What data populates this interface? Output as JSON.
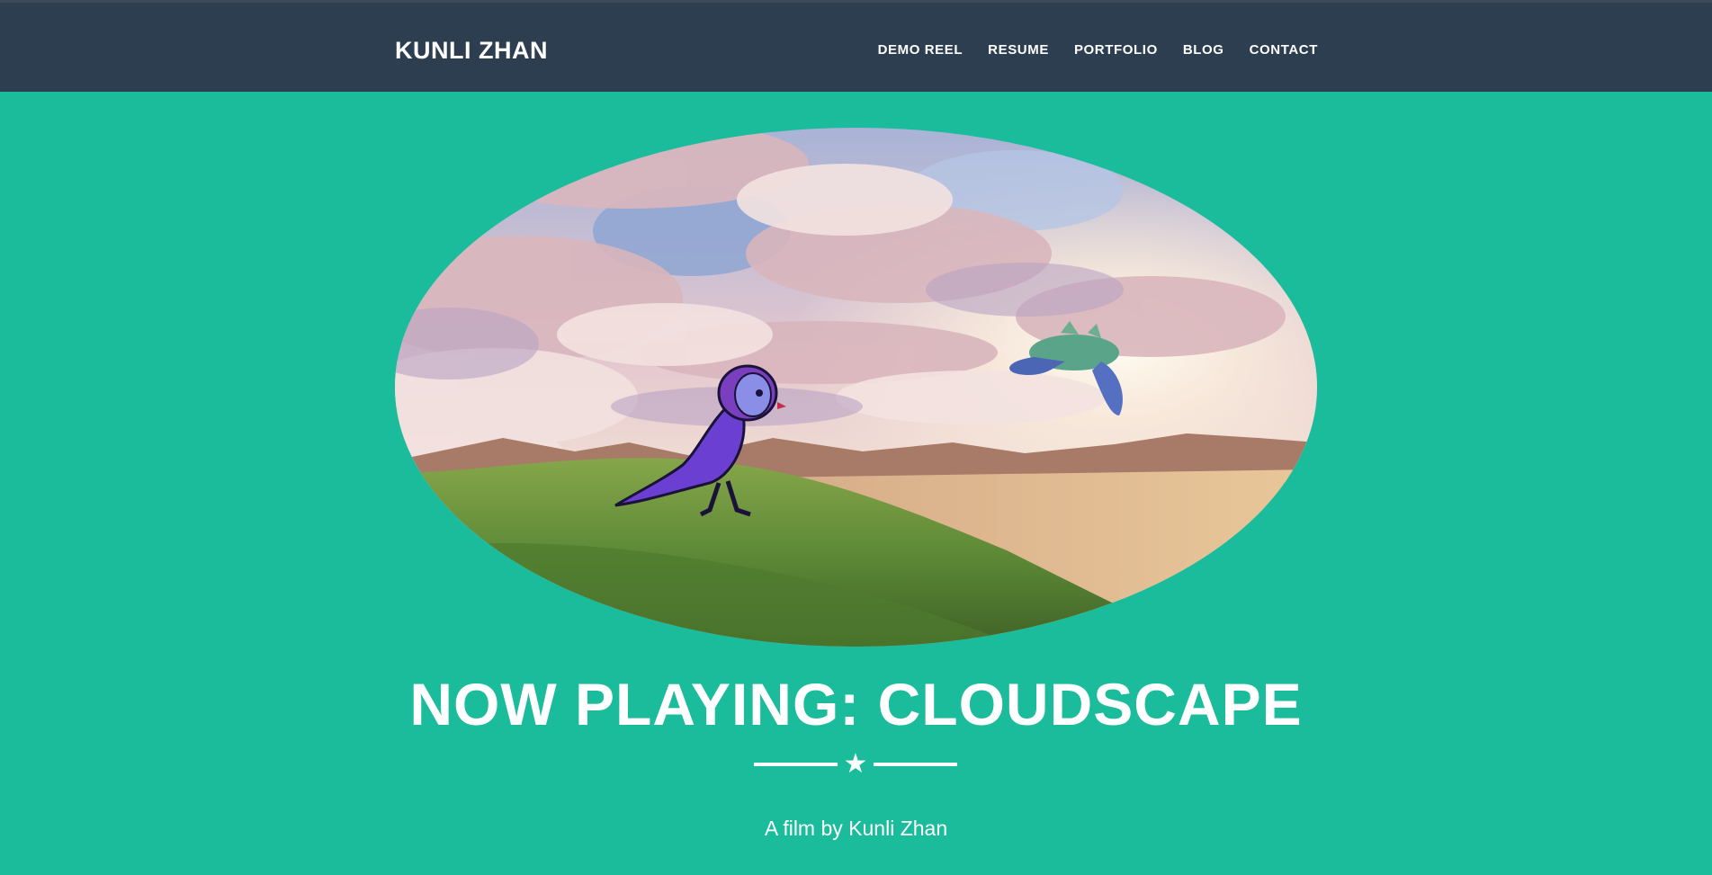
{
  "header": {
    "brand": "KUNLI ZHAN",
    "nav": [
      "DEMO REEL",
      "RESUME",
      "PORTFOLIO",
      "BLOG",
      "CONTACT"
    ]
  },
  "hero": {
    "headline": "NOW PLAYING: CLOUDSCAPE",
    "subtitle": "A film by Kunli Zhan",
    "divider_icon": "star-icon"
  },
  "colors": {
    "page_background": "#1abc9c",
    "header_background": "#2c3e50",
    "text": "#ffffff"
  }
}
